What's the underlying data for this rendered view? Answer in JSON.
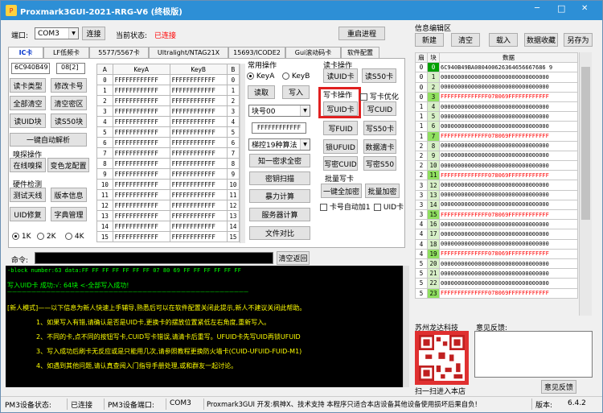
{
  "title": "Proxmark3GUI-2021-RRG-V6 (终极版)",
  "window_controls": {
    "min": "─",
    "max": "□",
    "close": "✕"
  },
  "port_label": "端口:",
  "port_value": "COM3",
  "connect_btn": "连接",
  "status_label": "当前状态:",
  "status_value": "已连接",
  "restart_btn": "重启进程",
  "tabs": [
    "IC卡",
    "LF低频卡",
    "5577/5567卡",
    "Ultralight/NTAG21X",
    "15693/ICODE2",
    "Gui滚动码卡",
    "软件配置"
  ],
  "uid": "6C940B49",
  "sak": "08[2]",
  "left_btns": {
    "read_type": "读卡类型",
    "modify_no": "修改卡号",
    "clear_all": "全部清空",
    "clear_key": "清空密区",
    "read_uid": "读UID块",
    "read_s50": "读S50块",
    "one_key": "一键自动解析"
  },
  "sniff_label": "嗅探操作",
  "sniff_btns": {
    "online": "在线嗅探",
    "chameleon": "变色龙配置"
  },
  "hw_label": "硬件检测",
  "hw_btns": {
    "antenna": "测试天线",
    "version": "版本信息",
    "uid_fix": "UID修复",
    "dict": "字典管理"
  },
  "radios": [
    "1K",
    "2K",
    "4K"
  ],
  "grid_headers": [
    "A",
    "KeyA",
    "KeyB",
    "B"
  ],
  "key": "FFFFFFFFFFFF",
  "common_label": "常用操作",
  "keya": "KeyA",
  "keyb": "KeyB",
  "read_btn": "读取",
  "write_btn": "写入",
  "block_sel": "块号00",
  "key_field": "FFFFFFFFFFFF",
  "mode_sel": "梯控19种算法",
  "mid_btns": {
    "known": "知一密求全密",
    "scan": "密钥扫描",
    "brute": "暴力计算",
    "server": "服务器计算",
    "compare": "文件对比"
  },
  "read_card_label": "读卡操作",
  "read_uid_card": "读UID卡",
  "read_s50_card": "读S50卡",
  "write_card_label": "写卡操作",
  "write_opt": "写卡优化",
  "write_btns": {
    "write_uid": "写UID卡",
    "write_cuid": "写CUID",
    "write_fuid": "写FUID",
    "write_s50": "写S50卡",
    "lock_ufuid": "锁UFUID",
    "clean_card": "数据清卡",
    "write_pwd_cuid": "写密CUID",
    "write_pwd_s50": "写密S50"
  },
  "batch_label": "批量写卡",
  "batch_btns": {
    "encrypt_all": "一键全加密",
    "batch_encrypt": "批量加密"
  },
  "batch_chk": {
    "auto_inc": "卡号自动加1",
    "uid_card": "UID卡"
  },
  "cmd_label": "命令:",
  "clear_return": "清空返回",
  "console_lines": [
    "-block number:63 data:FF FF FF FF FF FF FF 07 80 69 FF FF FF FF FF FF",
    "写入UID卡    成功:√: 64块  <-全部写入成功!",
    "——————————————————————————————————————————————————",
    "[新人模式]——以下信息为新人快速上手辅导,熟悉后可以在软件配置关闭此提示,新人不建议关闭此帮助。",
    "1、如果写入有错,请确认是否是UID卡,更换卡的摆放位置紧低左右角度,重新写入。",
    "2、不同的卡,点不同的按钮写卡,CUID写卡错误,请清卡后重写。UFUID卡先写UID再锁UFUID",
    "3、写入成功后刷卡无反应或是只能用几次,请参照教程更换防火墙卡(CUID-UFUID-FUID-M1)",
    "4、如遇到其他问题,请认真查阅入门指导手册处理,或和群友一起讨论。"
  ],
  "info_label": "信息编辑区",
  "right_btns": {
    "new": "新建",
    "clear": "清空",
    "load": "载入",
    "collect": "数据收藏",
    "save_as": "另存为"
  },
  "rgrid_headers": [
    "扇",
    "块",
    "数据"
  ],
  "rgrid_rows": [
    [
      "0",
      "0",
      "6C940B49BA080400626364656667686 9"
    ],
    [
      "0",
      "1",
      "00000000000000000000000000000000"
    ],
    [
      "0",
      "2",
      "00000000000000000000000000000000"
    ],
    [
      "0",
      "3",
      "FFFFFFFFFFFFFF078069FFFFFFFFFFFF"
    ],
    [
      "1",
      "4",
      "00000000000000000000000000000000"
    ],
    [
      "1",
      "5",
      "00000000000000000000000000000000"
    ],
    [
      "1",
      "6",
      "00000000000000000000000000000000"
    ],
    [
      "1",
      "7",
      "FFFFFFFFFFFFFF078069FFFFFFFFFFFF"
    ],
    [
      "2",
      "8",
      "00000000000000000000000000000000"
    ],
    [
      "2",
      "9",
      "00000000000000000000000000000000"
    ],
    [
      "2",
      "10",
      "00000000000000000000000000000000"
    ],
    [
      "2",
      "11",
      "FFFFFFFFFFFFFF078069FFFFFFFFFFFF"
    ],
    [
      "3",
      "12",
      "00000000000000000000000000000000"
    ],
    [
      "3",
      "13",
      "00000000000000000000000000000000"
    ],
    [
      "3",
      "14",
      "00000000000000000000000000000000"
    ],
    [
      "3",
      "15",
      "FFFFFFFFFFFFFF078069FFFFFFFFFFFF"
    ],
    [
      "4",
      "16",
      "00000000000000000000000000000000"
    ],
    [
      "4",
      "17",
      "00000000000000000000000000000000"
    ],
    [
      "4",
      "18",
      "00000000000000000000000000000000"
    ],
    [
      "4",
      "19",
      "FFFFFFFFFFFFFF078069FFFFFFFFFFFF"
    ],
    [
      "5",
      "20",
      "00000000000000000000000000000000"
    ],
    [
      "5",
      "21",
      "00000000000000000000000000000000"
    ],
    [
      "5",
      "22",
      "00000000000000000000000000000000"
    ],
    [
      "5",
      "23",
      "FFFFFFFFFFFFFF078069FFFFFFFFFFFF"
    ]
  ],
  "shop_label": "苏州龙达科技",
  "scan_label": "扫一扫进入本店",
  "feedback_label": "意见反馈:",
  "feedback_btn": "意见反馈",
  "statusbar": {
    "dev_status_label": "PM3设备状态:",
    "dev_status": "已连接",
    "dev_port_label": "PM3设备端口:",
    "dev_port": "COM3",
    "dev_info": "Proxmark3GUI 开发:枫神X、技术支持  本程序只适合本店设备其他设备使用损坏后果自负!",
    "version_label": "版本:",
    "version": "6.4.2"
  },
  "colors": {
    "title_bar": "#2d8fd6",
    "console_bg": "#000000",
    "console_green": "#00ff00",
    "status_red": "#ff0000",
    "highlight_red": "#e02020",
    "block0_green": "#00a000",
    "trailer_red": "#ff0000",
    "trailer_green": "#90e060"
  }
}
